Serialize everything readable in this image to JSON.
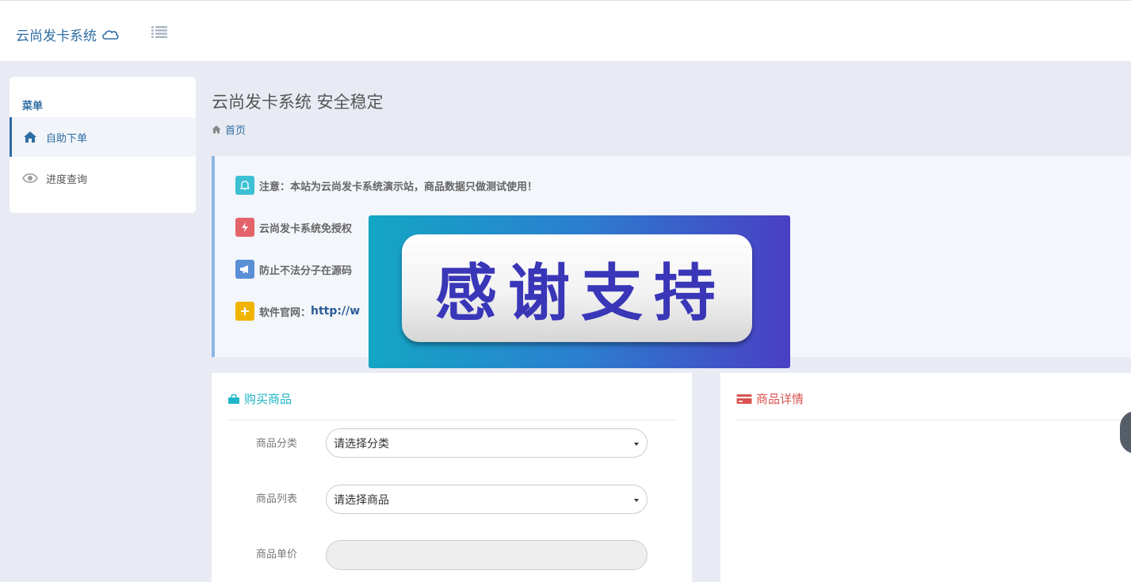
{
  "header": {
    "brand": "云尚发卡系统",
    "brand_icon": "cloud-icon",
    "toggle_icon": "list-icon"
  },
  "sidebar": {
    "title": "菜单",
    "items": [
      {
        "label": "自助下单",
        "icon": "home-icon",
        "active": true
      },
      {
        "label": "进度查询",
        "icon": "eye-icon",
        "active": false
      }
    ]
  },
  "page": {
    "title": "云尚发卡系统 安全稳定",
    "breadcrumb": "首页"
  },
  "notices": [
    {
      "text": "注意：本站为云尚发卡系统演示站，商品数据只做测试使用！",
      "icon": "bell-icon",
      "color": "#3cc0d3"
    },
    {
      "text": "云尚发卡系统免授权",
      "icon": "bolt-icon",
      "color": "#e5636b"
    },
    {
      "text": "防止不法分子在源码",
      "icon": "megaphone-icon",
      "color": "#5b8fd6"
    },
    {
      "text": "软件官网：",
      "link": "http://w",
      "icon": "plus-icon",
      "color": "#f0b400"
    }
  ],
  "popup": {
    "text": "感谢支持"
  },
  "buy_panel": {
    "title": "购买商品",
    "icon": "shopping-bag-icon",
    "fields": [
      {
        "label": "商品分类",
        "value": "请选择分类",
        "type": "select"
      },
      {
        "label": "商品列表",
        "value": "请选择商品",
        "type": "select"
      },
      {
        "label": "商品单价",
        "value": "",
        "type": "readonly"
      }
    ]
  },
  "detail_panel": {
    "title": "商品详情",
    "icon": "credit-card-icon"
  },
  "colors": {
    "accent": "#2e6da4",
    "teal": "#1fb5c8",
    "danger": "#d9534f",
    "background": "#e8ebf3"
  }
}
